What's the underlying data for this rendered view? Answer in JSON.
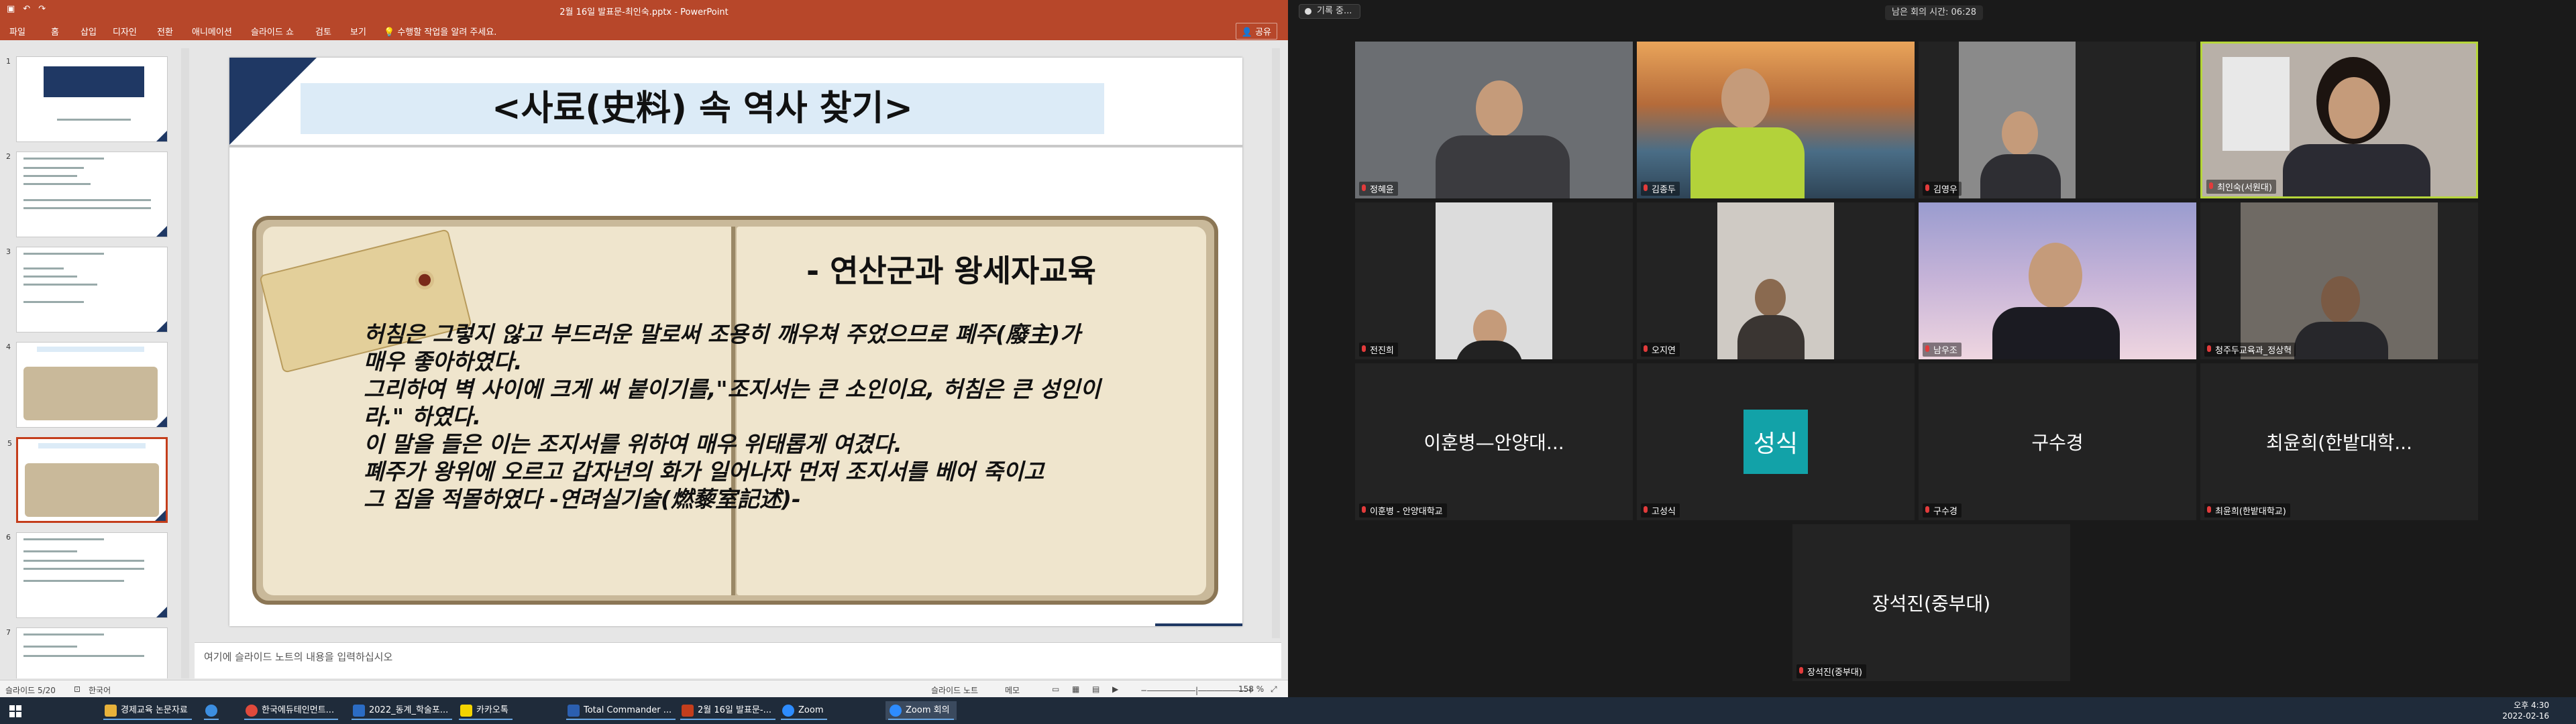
{
  "powerpoint": {
    "window_title": "2월 16일 발표문-최인숙.pptx  -  PowerPoint",
    "ribbon_tabs": [
      "파일",
      "홈",
      "삽입",
      "디자인",
      "전환",
      "애니메이션",
      "슬라이드 쇼",
      "검토",
      "보기"
    ],
    "tell_me": "수행할 작업을 알려 주세요.",
    "share": "공유",
    "thumbnails": [
      {
        "num": "1",
        "title": "역사교과서에 나타난 조선 왕세자교육과 왕실 교육의 의미와 한계"
      },
      {
        "num": "2",
        "title": "왕세자교육의 전개와 역사"
      },
      {
        "num": "3",
        "title": "왕세자교육의 전개와 역사"
      },
      {
        "num": "4",
        "title": "<사료(史料) 속 역사 찾기>"
      },
      {
        "num": "5",
        "title": "<사료(史料) 속 역사 찾기>"
      },
      {
        "num": "6",
        "title": "왕산생 협의를 위한 협의"
      },
      {
        "num": "7",
        "title": "왕산생 협의를 위한 협의"
      }
    ],
    "slide": {
      "title": "<사료(史料) 속 역사 찾기>",
      "subtitle": "- 연산군과 왕세자교육",
      "body": [
        "허침은 그렇지 않고 부드러운 말로써 조용히 깨우쳐 주었으므로 폐주(廢主)가",
        "매우 좋아하였다.",
        " 그리하여 벽 사이에 크게 써 붙이기를,\"조지서는 큰 소인이요, 허침은 큰 성인이",
        "라.\" 하였다.",
        "이 말을 들은 이는 조지서를 위하여 매우 위태롭게 여겼다.",
        "폐주가 왕위에 오르고 갑자년의 화가 일어나자 먼저 조지서를 베어 죽이고",
        "그 집을 적몰하였다 -연려실기술(燃藜室記述)-"
      ]
    },
    "notes_placeholder": "여기에 슬라이드 노트의 내용을 입력하십시오",
    "status": {
      "slide_count": "슬라이드 5/20",
      "language": "한국어",
      "notes": "슬라이드 노트",
      "comments": "메모",
      "zoom": "158 %"
    }
  },
  "zoom": {
    "recording": "기록 중...",
    "remaining": "남은 회의 시간: 06:28",
    "participants": [
      {
        "name": "정혜윤",
        "display": ""
      },
      {
        "name": "김종두",
        "display": ""
      },
      {
        "name": "김영우",
        "display": ""
      },
      {
        "name": "최인숙(서원대)",
        "display": ""
      },
      {
        "name": "전진희",
        "display": ""
      },
      {
        "name": "오지연",
        "display": ""
      },
      {
        "name": "남우조",
        "display": ""
      },
      {
        "name": "청주두교육과_정상혁",
        "display": ""
      },
      {
        "name": "이훈병 - 안양대학교",
        "display": "이훈병—안양대..."
      },
      {
        "name": "고성식",
        "display": "성식"
      },
      {
        "name": "구수경",
        "display": "구수경"
      },
      {
        "name": "최윤희(한밭대학교)",
        "display": "최윤희(한밭대학..."
      },
      {
        "name": "장석진(중부대)",
        "display": "장석진(중부대)"
      }
    ]
  },
  "taskbar": {
    "items": [
      {
        "label": "경제교육 논문자료",
        "color": "#e8b23a"
      },
      {
        "label": "",
        "color": "#3c8ee0"
      },
      {
        "label": "한국에듀테인먼트...",
        "color": "#e04a3c"
      },
      {
        "label": "2022_동계_학술포...",
        "color": "#2b6cc4"
      },
      {
        "label": "카카오톡",
        "color": "#f4d400"
      },
      {
        "label": "Total Commander ...",
        "color": "#2b5fb0"
      },
      {
        "label": "2월 16일 발표문-...",
        "color": "#c43e1c"
      },
      {
        "label": "Zoom",
        "color": "#2d8cff"
      },
      {
        "label": "Zoom 회의",
        "color": "#2d8cff"
      }
    ],
    "time": "오후 4:30",
    "date": "2022-02-16"
  }
}
